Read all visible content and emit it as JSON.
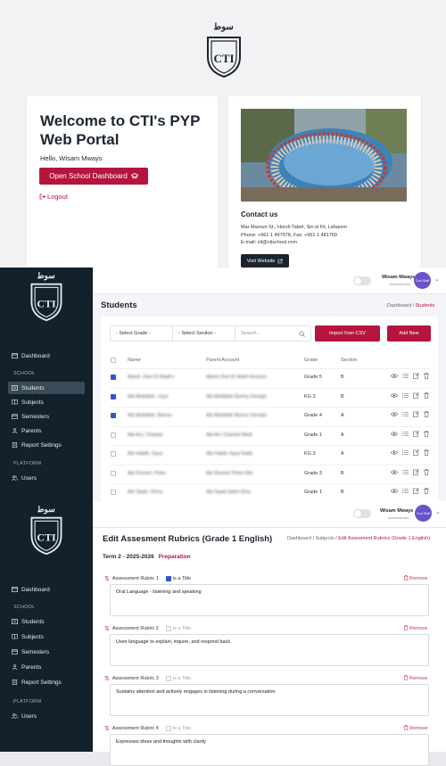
{
  "colors": {
    "brand": "#b5153d",
    "sidebar": "#13212c",
    "accent_blue": "#2f55d4",
    "avatar": "#6a52c9"
  },
  "welcome": {
    "logo_script": "ﺳﻮ ﻃ",
    "title": "Welcome to CTI's PYP Web Portal",
    "hello": "Hello, Wisam Mways",
    "dashboard_button": "Open School Dashboard",
    "logout": "Logout",
    "contact": {
      "title": "Contact us",
      "address": "Mar Maroun St., Horsh Tabet, Sin el Fil, Lebanon",
      "phone": "Phone: +961 1 497978, Fax: +961 1 481769",
      "email": "E-mail: cti@ctischool.com",
      "visit_button": "Visit Website"
    }
  },
  "sidebar": {
    "dashboard": "Dashboard",
    "school_section": "SCHOOL",
    "items": [
      "Students",
      "Subjects",
      "Semesters",
      "Parents",
      "Report Settings"
    ],
    "platform_section": "PLATFORM",
    "users": "Users"
  },
  "topbar_students": {
    "name": "Wisam Mways",
    "role": "Administrator",
    "avatar_text": "Cool Staff"
  },
  "topbar_rubrics": {
    "name": "Wisam Mways",
    "role": "Administrator",
    "avatar_text": "Cool Staff"
  },
  "students_page": {
    "title": "Students",
    "breadcrumb": {
      "home": "Dashboard",
      "sep": "/",
      "current": "Students"
    },
    "filters": {
      "grade": "- Select Grade -",
      "section": "- Select Section -",
      "search_placeholder": "Search..."
    },
    "import_button": "Import from CSV",
    "add_button": "Add New",
    "columns": {
      "name": "Name",
      "parent": "Parent Account",
      "grade": "Grade",
      "section": "Section"
    },
    "rows": [
      {
        "checked": true,
        "name": "Abeel, Zein El Wadi'n",
        "parent": "Abeel Zein El Wadi Hussein",
        "grade": "Grade 5",
        "section": "B"
      },
      {
        "checked": true,
        "name": "Abi Abdallah, Joya",
        "parent": "Abi Abdallah Barmy George",
        "grade": "KG 3",
        "section": "B"
      },
      {
        "checked": true,
        "name": "Abi Abdallah, Barmy",
        "parent": "Abi Abdallah Barmy George",
        "grade": "Grade 4",
        "section": "A"
      },
      {
        "checked": false,
        "name": "Abi Arz, Chantal",
        "parent": "Abi Arz Chantal Wadi",
        "grade": "Grade 1",
        "section": "A"
      },
      {
        "checked": false,
        "name": "Abi Habib, Saya",
        "parent": "Abi Habib Saya Nabil",
        "grade": "KG 3",
        "section": "A"
      },
      {
        "checked": false,
        "name": "Abi Rumeir, Peter",
        "parent": "Abi Rumeir Peter Elie",
        "grade": "Grade 3",
        "section": "B"
      },
      {
        "checked": false,
        "name": "Abi Saab, Omra",
        "parent": "Abi Saad Salim Elou",
        "grade": "Grade 1",
        "section": "B"
      }
    ]
  },
  "rubrics_page": {
    "title": "Edit Assesment Rubrics (Grade 1 English)",
    "breadcrumb": {
      "home": "Dashboard",
      "mid": "Subjects",
      "current": "Edit Assesment Rubrics (Grade 1 English)"
    },
    "term": "Term 2 - 2025-2026",
    "status": "Preparation",
    "is_title_label": "is a Title",
    "remove_label": "Remove",
    "rubrics": [
      {
        "label": "Assessment Rubric 1",
        "is_title": true,
        "text": "Oral Language - listening and speaking"
      },
      {
        "label": "Assessment Rubric 2",
        "is_title": false,
        "text": "Uses language to explain, inquire, and respond back"
      },
      {
        "label": "Assessment Rubric 3",
        "is_title": false,
        "text": "Sustains attention and actively engages in listening during a conversation"
      },
      {
        "label": "Assessment Rubric 4",
        "is_title": false,
        "text": "Expresses ideas and thoughts with clarity"
      }
    ]
  }
}
